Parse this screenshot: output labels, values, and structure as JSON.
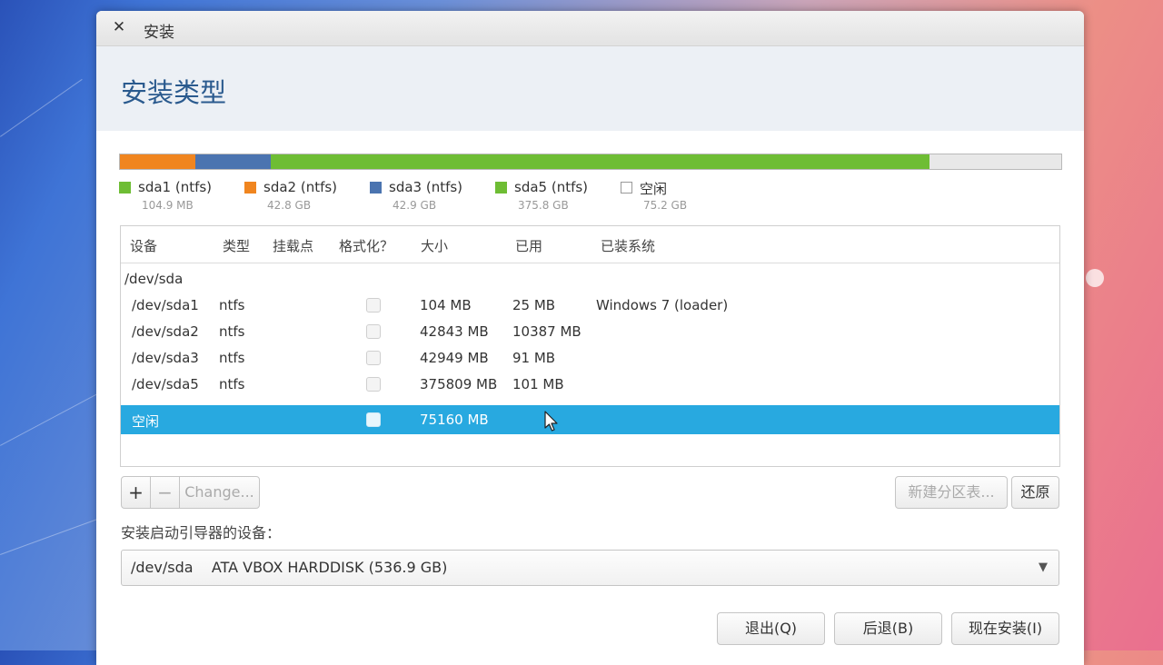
{
  "window": {
    "title": "安装",
    "close_icon": "✕"
  },
  "header": {
    "page_title": "安装类型"
  },
  "partition_bar": [
    {
      "name": "sda1",
      "fraction": 0.0002,
      "color": "#f0851f"
    },
    {
      "name": "sda2",
      "fraction": 0.0797,
      "color": "#f0851f"
    },
    {
      "name": "sda3",
      "fraction": 0.08,
      "color": "#4b74b0"
    },
    {
      "name": "sda5",
      "fraction": 0.7001,
      "color": "#6ebd34"
    },
    {
      "name": "free",
      "fraction": 0.14,
      "color": "#e8e8e8"
    }
  ],
  "legend": [
    {
      "name": "sda1 (ntfs)",
      "size": "104.9 MB",
      "color": "#6ebd34"
    },
    {
      "name": "sda2 (ntfs)",
      "size": "42.8 GB",
      "color": "#f0851f"
    },
    {
      "name": "sda3 (ntfs)",
      "size": "42.9 GB",
      "color": "#4b74b0"
    },
    {
      "name": "sda5 (ntfs)",
      "size": "375.8 GB",
      "color": "#6ebd34"
    },
    {
      "name": "空闲",
      "size": "75.2 GB",
      "color": "#ffffff"
    }
  ],
  "table": {
    "headers": [
      "设备",
      "类型",
      "挂载点",
      "格式化？",
      "大小",
      "已用",
      "已装系统"
    ],
    "group": "/dev/sda",
    "rows": [
      {
        "device": "/dev/sda1",
        "type": "ntfs",
        "size": "104 MB",
        "used": "25 MB",
        "system": "Windows 7 (loader)"
      },
      {
        "device": "/dev/sda2",
        "type": "ntfs",
        "size": "42843 MB",
        "used": "10387 MB",
        "system": ""
      },
      {
        "device": "/dev/sda3",
        "type": "ntfs",
        "size": "42949 MB",
        "used": "91 MB",
        "system": ""
      },
      {
        "device": "/dev/sda5",
        "type": "ntfs",
        "size": "375809 MB",
        "used": "101 MB",
        "system": ""
      },
      {
        "device": "空闲",
        "type": "",
        "size": "75160 MB",
        "used": "",
        "system": ""
      }
    ]
  },
  "buttons": {
    "add": "+",
    "remove": "−",
    "change": "Change...",
    "new_table": "新建分区表...",
    "revert": "还原",
    "quit": "退出(Q)",
    "back": "后退(B)",
    "install_now": "现在安装(I)"
  },
  "boot": {
    "label": "安装启动引导器的设备：",
    "value": "/dev/sda    ATA VBOX HARDDISK (536.9 GB)",
    "arrow_icon": "▼"
  }
}
